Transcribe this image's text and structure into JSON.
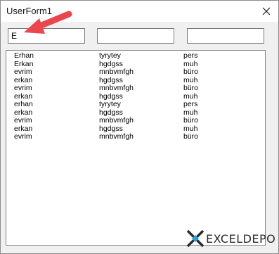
{
  "window": {
    "title": "UserForm1"
  },
  "textboxes": [
    {
      "value": "E"
    },
    {
      "value": ""
    },
    {
      "value": ""
    }
  ],
  "listbox": {
    "rows": [
      [
        "Erhan",
        "tyrytey",
        "pers"
      ],
      [
        "Erkan",
        "hgdgss",
        "muh"
      ],
      [
        "evrim",
        "mnbvmfgh",
        "büro"
      ],
      [
        "erkan",
        "hgdgss",
        "muh"
      ],
      [
        "evrim",
        "mnbvmfgh",
        "büro"
      ],
      [
        "erkan",
        "hgdgss",
        "muh"
      ],
      [
        "erhan",
        "tyrytey",
        "pers"
      ],
      [
        "erkan",
        "hgdgss",
        "muh"
      ],
      [
        "evrim",
        "mnbvmfgh",
        "büro"
      ],
      [
        "erkan",
        "hgdgss",
        "muh"
      ],
      [
        "evrim",
        "mnbvmfgh",
        "büro"
      ]
    ]
  },
  "annotation": {
    "arrow_color": "#e8474c"
  },
  "watermark": {
    "text": "EXCELDEPO",
    "accent_color": "#2ba3d6"
  },
  "icons": {
    "close": "close-icon",
    "logo": "exceldepo-logo-icon"
  }
}
